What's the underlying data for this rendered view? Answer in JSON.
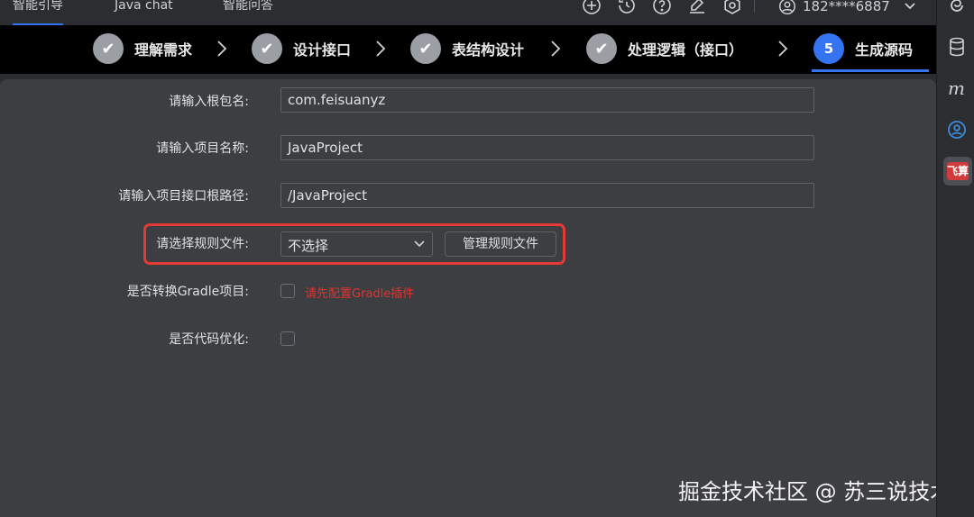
{
  "tabs": [
    {
      "label": "智能引导",
      "active": true
    },
    {
      "label": "Java chat",
      "active": false
    },
    {
      "label": "智能问答",
      "active": false
    }
  ],
  "toolbar_icons": [
    "plus-circle-icon",
    "history-icon",
    "help-icon",
    "edit-icon",
    "settings-icon"
  ],
  "user": {
    "phone": "182****6887"
  },
  "steps": [
    {
      "label": "理解需求",
      "state": "done",
      "marker": "✔"
    },
    {
      "label": "设计接口",
      "state": "done",
      "marker": "✔"
    },
    {
      "label": "表结构设计",
      "state": "done",
      "marker": "✔"
    },
    {
      "label": "处理逻辑（接口）",
      "state": "done",
      "marker": "✔"
    },
    {
      "label": "生成源码",
      "state": "active",
      "marker": "5"
    }
  ],
  "form": {
    "root_package_label": "请输入根包名:",
    "root_package_value": "com.feisuanyz",
    "project_name_label": "请输入项目名称:",
    "project_name_value": "JavaProject",
    "api_root_path_label": "请输入项目接口根路径:",
    "api_root_path_value": "/JavaProject",
    "rule_file_label": "请选择规则文件:",
    "rule_file_selected": "不选择",
    "manage_rules_button": "管理规则文件",
    "gradle_label": "是否转换Gradle项目:",
    "gradle_warning": "请先配置Gradle插件",
    "optimize_label": "是否代码优化:"
  },
  "watermark": "掘金技术社区 @ 苏三说技术",
  "sidebar": {
    "feishu_label": "飞算"
  },
  "colors": {
    "accent": "#3574f0",
    "highlight": "#e53935",
    "warning": "#e3322f"
  }
}
